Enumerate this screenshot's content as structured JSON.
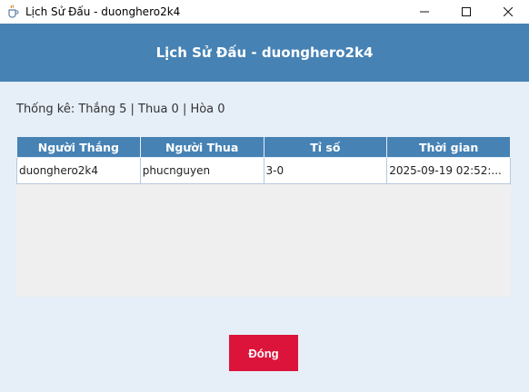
{
  "window": {
    "title": "Lịch Sử Đấu - duonghero2k4",
    "icon": "java-cup-icon"
  },
  "header": {
    "title": "Lịch Sử Đấu - duonghero2k4",
    "color": "#4682b4"
  },
  "stats": {
    "text": "Thống kê: Thắng 5 | Thua 0 | Hòa 0"
  },
  "table": {
    "columns": [
      "Người Thắng",
      "Người Thua",
      "Tỉ số",
      "Thời gian"
    ],
    "rows": [
      [
        "duonghero2k4",
        "phucnguyen",
        "3-0",
        "2025-09-19 02:52:..."
      ]
    ]
  },
  "actions": {
    "close_label": "Đóng",
    "close_color": "#dc143c"
  }
}
